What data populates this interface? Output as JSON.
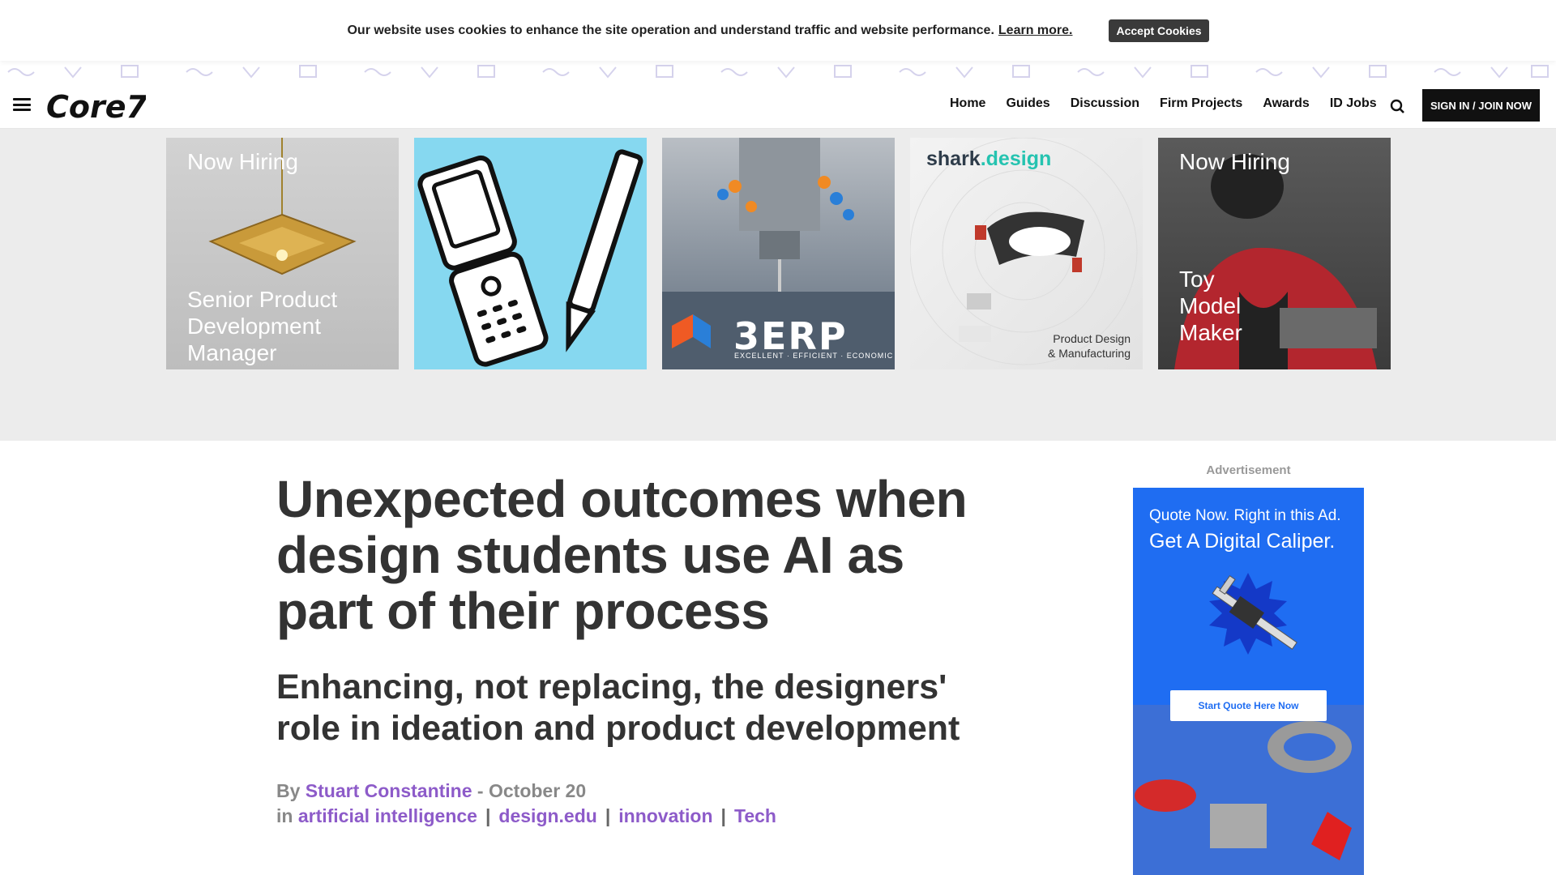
{
  "cookie": {
    "message": "Our website uses cookies to enhance the site operation and understand traffic and website performance.",
    "learn_more": "Learn more.",
    "accept": "Accept Cookies"
  },
  "header": {
    "logo_text": "Core77",
    "nav": [
      "Home",
      "Guides",
      "Discussion",
      "Firm Projects",
      "Awards",
      "ID Jobs"
    ],
    "signin": "SIGN IN / JOIN NOW"
  },
  "ads": {
    "tile1": {
      "eyebrow": "Now Hiring",
      "title": "Senior Product Development Manager"
    },
    "tile3": {
      "brand": "3ERP",
      "tagline": "EXCELLENT · EFFICIENT · ECONOMIC"
    },
    "tile4": {
      "brand_a": "shark",
      "brand_b": ".design",
      "caption_1": "Product Design",
      "caption_2": "& Manufacturing"
    },
    "tile5": {
      "eyebrow": "Now Hiring",
      "title_1": "Toy",
      "title_2": "Model",
      "title_3": "Maker"
    }
  },
  "article": {
    "title": "Unexpected outcomes when design students use AI as part of their process",
    "subtitle": "Enhancing, not replacing, the designers' role in ideation and product development",
    "by_prefix": "By",
    "author": "Stuart Constantine",
    "date_sep": "-",
    "date": "October 20",
    "tags_prefix": "in",
    "tags": [
      "artificial intelligence",
      "design.edu",
      "innovation",
      "Tech"
    ]
  },
  "sidebar": {
    "ad_label": "Advertisement",
    "ad_line1": "Quote Now. Right in this Ad.",
    "ad_line2": "Get A Digital Caliper.",
    "ad_button": "Start Quote Here Now"
  },
  "colors": {
    "accent_purple": "#8d5bc9",
    "ad_blue": "#1f6df2",
    "ad_strip_bg": "#ececec"
  }
}
